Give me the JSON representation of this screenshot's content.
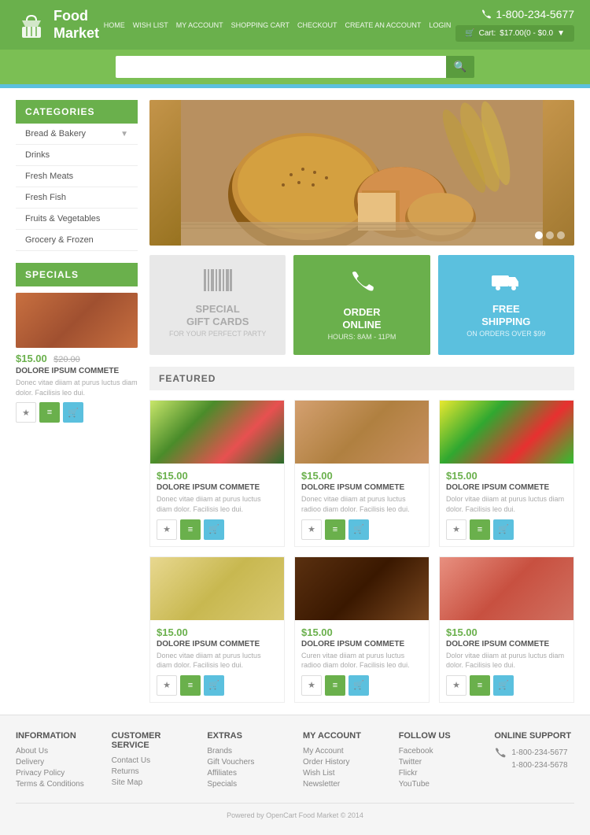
{
  "header": {
    "logo_text_line1": "Food",
    "logo_text_line2": "Market",
    "phone": "1-800-234-5677",
    "cart_label": "Cart:",
    "cart_amount": "$17.00(0 - $0.0",
    "nav_links": [
      "HOME",
      "WISH LIST",
      "MY ACCOUNT",
      "SHOPPING CART",
      "CHECKOUT",
      "CREATE AN ACCOUNT",
      "LOGIN"
    ],
    "search_placeholder": ""
  },
  "sidebar": {
    "categories_title": "CATEGORIES",
    "categories": [
      {
        "label": "Bread & Bakery",
        "has_chevron": true
      },
      {
        "label": "Drinks",
        "has_chevron": false
      },
      {
        "label": "Fresh Meats",
        "has_chevron": false
      },
      {
        "label": "Fresh Fish",
        "has_chevron": false
      },
      {
        "label": "Fruits & Vegetables",
        "has_chevron": false
      },
      {
        "label": "Grocery & Frozen",
        "has_chevron": false
      }
    ],
    "specials_title": "SPECIALS",
    "special_product": {
      "price": "$15.00",
      "old_price": "$20.00",
      "name": "DOLORE IPSUM COMMETE",
      "desc": "Donec vitae diiam at purus luctus diam dolor. Facilisis leo dui."
    }
  },
  "promo_boxes": [
    {
      "icon": "barcode",
      "title": "SPECIAL\nGIFT CARDS",
      "subtitle": "FOR YOUR PERFECT PARTY",
      "type": "gray"
    },
    {
      "icon": "phone",
      "title": "ORDER\nONLINE",
      "subtitle": "HOURS: 8AM - 11PM",
      "type": "green"
    },
    {
      "icon": "truck",
      "title": "FREE\nSHIPPING",
      "subtitle": "ON ORDERS OVER $99",
      "type": "blue"
    }
  ],
  "featured_title": "FEATURED",
  "products": [
    {
      "price": "$15.00",
      "name": "DOLORE IPSUM COMMETE",
      "desc": "Donec vitae diiam at purus luctus diam dolor. Facilisis leo dui.",
      "bg": "veggies"
    },
    {
      "price": "$15.00",
      "name": "DOLORE IPSUM COMMETE",
      "desc": "Donec vitae diiam at purus luctus radioo diam dolor. Facilisis leo dui.",
      "bg": "cookies"
    },
    {
      "price": "$15.00",
      "name": "DOLORE IPSUM COMMETE",
      "desc": "Dolor vitae diiam at purus luctus diam dolor. Facilisis leo dui.",
      "bg": "tomatoes"
    },
    {
      "price": "$15.00",
      "name": "DOLORE IPSUM COMMETE",
      "desc": "Donec vitae diiam at purus luctus diam dolor. Facilisis leo dui.",
      "bg": "pasta"
    },
    {
      "price": "$15.00",
      "name": "DOLORE IPSUM COMMETE",
      "desc": "Curen vitae diiam at purus luctus radioo diam dolor. Facilisis leo dui.",
      "bg": "chocolate"
    },
    {
      "price": "$15.00",
      "name": "DOLORE IPSUM COMMETE",
      "desc": "Dolor vitae diiam at purus luctus diam dolor. Facilisis leo dui.",
      "bg": "meat"
    }
  ],
  "footer": {
    "information_title": "INFORMATION",
    "information_links": [
      "About Us",
      "Delivery",
      "Privacy Policy",
      "Terms & Conditions"
    ],
    "customer_service_title": "CUSTOMER SERVICE",
    "customer_service_links": [
      "Contact Us",
      "Returns",
      "Site Map"
    ],
    "extras_title": "EXTRAS",
    "extras_links": [
      "Brands",
      "Gift Vouchers",
      "Affiliates",
      "Specials"
    ],
    "my_account_title": "MY ACCOUNT",
    "my_account_links": [
      "My Account",
      "Order History",
      "Wish List",
      "Newsletter"
    ],
    "follow_us_title": "FOLLOW US",
    "follow_us_links": [
      "Facebook",
      "Twitter",
      "Flickr",
      "YouTube"
    ],
    "online_support_title": "ONLINE SUPPORT",
    "support_phone1": "1-800-234-5677",
    "support_phone2": "1-800-234-5678",
    "copyright": "Powered by OpenCart Food Market © 2014"
  },
  "actions": {
    "wishlist_icon": "★",
    "compare_icon": "≡",
    "cart_icon": "🛒"
  }
}
